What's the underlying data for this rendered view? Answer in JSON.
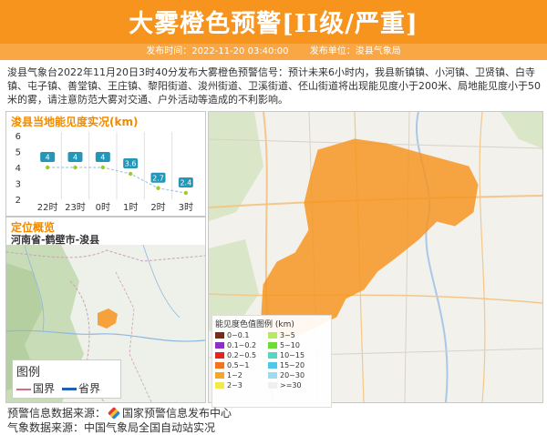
{
  "header": {
    "title": "大雾橙色预警[II级/严重]",
    "publish_time": "发布时间：2022-11-20 03:40:00",
    "publish_unit": "发布单位：浚县气象局"
  },
  "description": "浚县气象台2022年11月20日3时40分发布大雾橙色预警信号：预计未来6小时内，我县新镇镇、小河镇、卫贤镇、白寺镇、屯子镇、善堂镇、王庄镇、黎阳街道、浚州街道、卫溪街道、伾山街道将出现能见度小于200米、局地能见度小于50米的雾，请注意防范大雾对交通、户外活动等造成的不利影响。",
  "visibility_panel": {
    "title": "浚县当地能见度实况(km)"
  },
  "chart_data": {
    "type": "line",
    "title": "浚县当地能见度实况(km)",
    "categories": [
      "22时",
      "23时",
      "0时",
      "1时",
      "2时",
      "3时"
    ],
    "values": [
      4,
      4,
      4,
      3.6,
      2.7,
      2.4
    ],
    "yticks": [
      2,
      3,
      4,
      5,
      6
    ],
    "ylim": [
      2,
      6
    ],
    "colors": {
      "line": "#a6c8e0",
      "label": "#2496b8",
      "marker": "#9bcc2a"
    }
  },
  "location_panel": {
    "title": "定位概览",
    "region": "河南省-鹤壁市-浚县"
  },
  "map_legend": {
    "title": "图例",
    "items": [
      "国界",
      "省界"
    ]
  },
  "visibility_legend": {
    "title": "能见度色值图例 (km)",
    "items": [
      {
        "label": "0~0.1",
        "color": "#7b2a18"
      },
      {
        "label": "3~5",
        "color": "#b7ea63"
      },
      {
        "label": "0.1~0.2",
        "color": "#8e2dc2"
      },
      {
        "label": "5~10",
        "color": "#6ddc36"
      },
      {
        "label": "0.2~0.5",
        "color": "#e8231f"
      },
      {
        "label": "10~15",
        "color": "#56d8c0"
      },
      {
        "label": "0.5~1",
        "color": "#f5731c"
      },
      {
        "label": "15~20",
        "color": "#4ec8e8"
      },
      {
        "label": "1~2",
        "color": "#f5a623"
      },
      {
        "label": "20~30",
        "color": "#9bdcf0"
      },
      {
        "label": "2~3",
        "color": "#f2e94a"
      },
      {
        "label": ">=30",
        "color": "#f0f0f0"
      }
    ]
  },
  "footer": {
    "source_label": "预警信息数据来源：",
    "source_org": "国家预警信息发布中心",
    "data_source": "气象数据来源：中国气象局全国自动站实况"
  }
}
